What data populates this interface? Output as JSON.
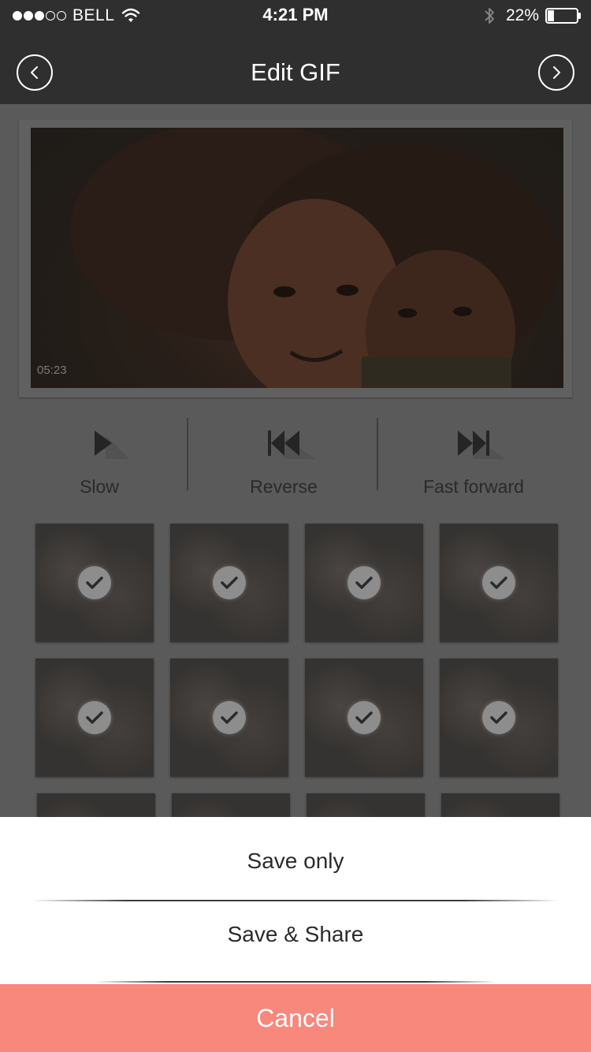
{
  "status_bar": {
    "signal_bars_filled": 3,
    "signal_bars_total": 5,
    "carrier": "BELL",
    "time": "4:21 PM",
    "battery": "22%",
    "battery_level": 0.22,
    "icons": [
      "wifi-icon",
      "bluetooth-icon",
      "battery-icon"
    ]
  },
  "nav": {
    "title": "Edit GIF",
    "back_icon": "chevron-left-icon",
    "next_icon": "chevron-right-icon"
  },
  "video": {
    "timestamp": "05:23"
  },
  "controls": [
    {
      "label": "Slow",
      "icon": "play-icon"
    },
    {
      "label": "Reverse",
      "icon": "rewind-icon"
    },
    {
      "label": "Fast forward",
      "icon": "fast-forward-icon"
    }
  ],
  "frames": {
    "selected_count_visible": 8,
    "check_icon": "check-icon"
  },
  "action_sheet": {
    "save_only": "Save only",
    "save_share": "Save & Share",
    "cancel": "Cancel"
  },
  "colors": {
    "cancel_bg": "#f8877c",
    "nav_bg": "#2f2f2f"
  }
}
